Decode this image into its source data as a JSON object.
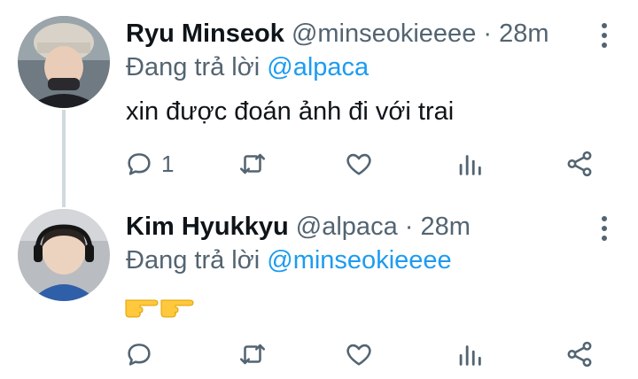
{
  "tweets": [
    {
      "name": "Ryu Minseok",
      "handle": "@minseokieeee",
      "separator": "·",
      "time": "28m",
      "reply_prefix": "Đang trả lời",
      "reply_to": "@alpaca",
      "text": "xin được đoán ảnh đi với trai",
      "reply_count": "1",
      "retweet_count": "",
      "like_count": ""
    },
    {
      "name": "Kim Hyukkyu",
      "handle": "@alpaca",
      "separator": "·",
      "time": "28m",
      "reply_prefix": "Đang trả lời",
      "reply_to": "@minseokieeee",
      "emoji": "👉👉",
      "reply_count": "",
      "retweet_count": "",
      "like_count": ""
    }
  ],
  "colors": {
    "text": "#0f1419",
    "secondary": "#536471",
    "link": "#1d9bf0",
    "thread_line": "#cfd9de"
  },
  "icons": [
    "reply-icon",
    "retweet-icon",
    "like-icon",
    "views-icon",
    "share-icon",
    "more-icon"
  ]
}
